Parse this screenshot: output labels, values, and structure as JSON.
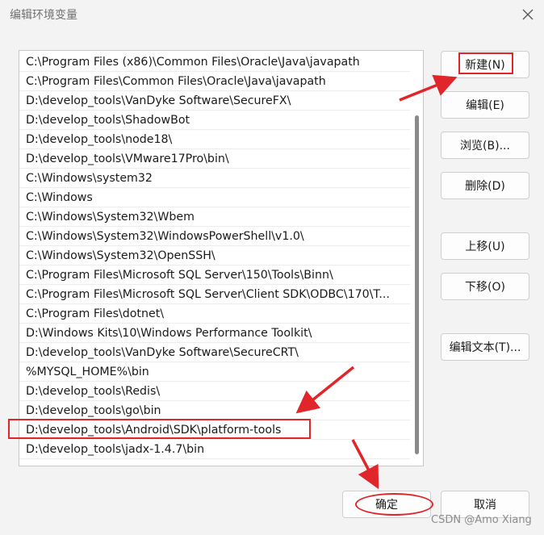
{
  "window": {
    "title": "编辑环境变量"
  },
  "paths": [
    "C:\\Program Files (x86)\\Common Files\\Oracle\\Java\\javapath",
    "C:\\Program Files\\Common Files\\Oracle\\Java\\javapath",
    "D:\\develop_tools\\VanDyke Software\\SecureFX\\",
    "D:\\develop_tools\\ShadowBot",
    "D:\\develop_tools\\node18\\",
    "D:\\develop_tools\\VMware17Pro\\bin\\",
    "C:\\Windows\\system32",
    "C:\\Windows",
    "C:\\Windows\\System32\\Wbem",
    "C:\\Windows\\System32\\WindowsPowerShell\\v1.0\\",
    "C:\\Windows\\System32\\OpenSSH\\",
    "C:\\Program Files\\Microsoft SQL Server\\150\\Tools\\Binn\\",
    "C:\\Program Files\\Microsoft SQL Server\\Client SDK\\ODBC\\170\\T...",
    "C:\\Program Files\\dotnet\\",
    "D:\\Windows Kits\\10\\Windows Performance Toolkit\\",
    "D:\\develop_tools\\VanDyke Software\\SecureCRT\\",
    "%MYSQL_HOME%\\bin",
    "D:\\develop_tools\\Redis\\",
    "D:\\develop_tools\\go\\bin",
    "D:\\develop_tools\\Android\\SDK\\platform-tools",
    "D:\\develop_tools\\jadx-1.4.7\\bin"
  ],
  "buttons": {
    "new": "新建(N)",
    "edit": "编辑(E)",
    "browse": "浏览(B)...",
    "delete": "删除(D)",
    "move_up": "上移(U)",
    "move_down": "下移(O)",
    "edit_text": "编辑文本(T)...",
    "ok": "确定",
    "cancel": "取消"
  },
  "annotation_color": "#e0262b",
  "watermark": "CSDN @Amo Xiang"
}
